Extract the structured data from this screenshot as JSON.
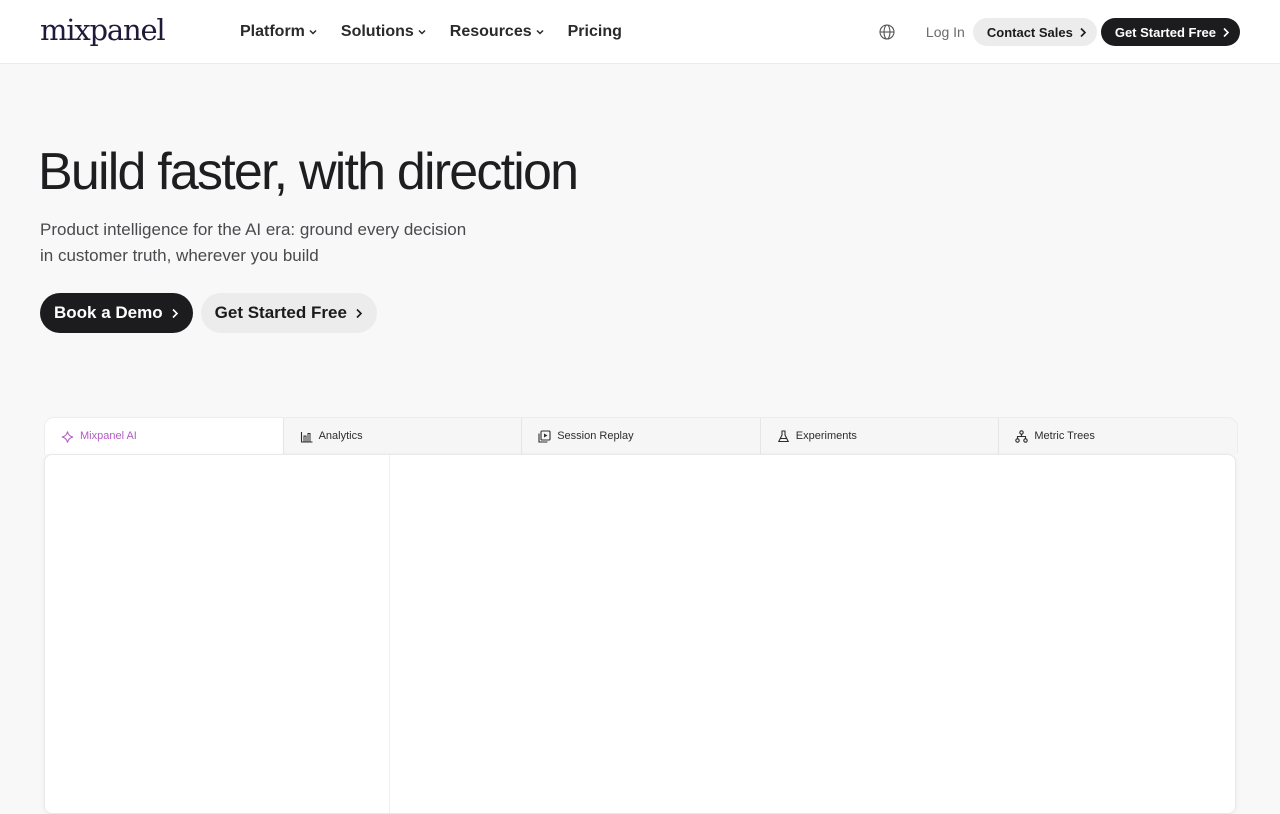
{
  "brand": {
    "logo_text": "mixpanel"
  },
  "nav": {
    "links": [
      {
        "label": "Platform",
        "has_menu": true
      },
      {
        "label": "Solutions",
        "has_menu": true
      },
      {
        "label": "Resources",
        "has_menu": true
      },
      {
        "label": "Pricing",
        "has_menu": false
      }
    ],
    "login_label": "Log In",
    "contact_label": "Contact Sales",
    "get_started_label": "Get Started Free"
  },
  "hero": {
    "title": "Build faster, with direction",
    "subtitle_line1": "Product intelligence for the AI era: ground every decision",
    "subtitle_line2": "in customer truth, wherever you build",
    "cta_primary": "Book a Demo",
    "cta_secondary": "Get Started Free"
  },
  "product_tabs": [
    {
      "label": "Mixpanel AI",
      "icon": "sparkle-icon",
      "active": true
    },
    {
      "label": "Analytics",
      "icon": "bar-chart-icon",
      "active": false
    },
    {
      "label": "Session Replay",
      "icon": "replay-icon",
      "active": false
    },
    {
      "label": "Experiments",
      "icon": "flask-icon",
      "active": false
    },
    {
      "label": "Metric Trees",
      "icon": "tree-icon",
      "active": false
    }
  ],
  "colors": {
    "accent_ai": "#b25bc6",
    "dark_button": "#1c1c1e",
    "light_button": "#ececec",
    "page_background": "#f8f8f8"
  }
}
